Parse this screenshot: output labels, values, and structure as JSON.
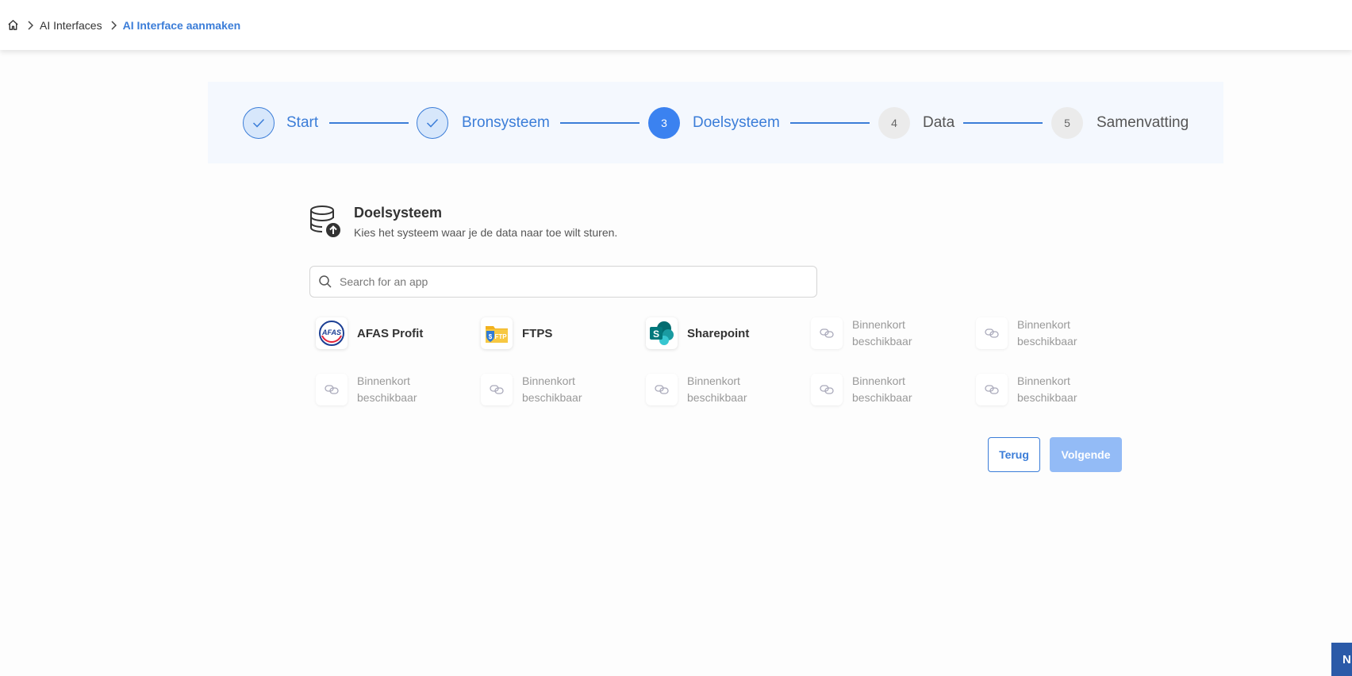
{
  "breadcrumb": {
    "home_icon": "home-icon",
    "items": [
      "AI Interfaces",
      "AI Interface aanmaken"
    ]
  },
  "stepper": {
    "steps": [
      {
        "number": "1",
        "label": "Start",
        "state": "done"
      },
      {
        "number": "2",
        "label": "Bronsysteem",
        "state": "done"
      },
      {
        "number": "3",
        "label": "Doelsysteem",
        "state": "active"
      },
      {
        "number": "4",
        "label": "Data",
        "state": "todo"
      },
      {
        "number": "5",
        "label": "Samenvatting",
        "state": "todo"
      }
    ]
  },
  "section": {
    "icon": "database-upload-icon",
    "title": "Doelsysteem",
    "subtitle": "Kies het systeem waar je de data naar toe wilt sturen."
  },
  "search": {
    "placeholder": "Search for an app",
    "value": ""
  },
  "apps": [
    {
      "name": "AFAS Profit",
      "logo": "afas-logo"
    },
    {
      "name": "FTPS",
      "logo": "ftp-logo"
    },
    {
      "name": "Sharepoint",
      "logo": "sharepoint-logo"
    },
    {
      "name": "Binnenkort beschikbaar",
      "logo": "link-icon"
    },
    {
      "name": "Binnenkort beschikbaar",
      "logo": "link-icon"
    },
    {
      "name": "Binnenkort beschikbaar",
      "logo": "link-icon"
    },
    {
      "name": "Binnenkort beschikbaar",
      "logo": "link-icon"
    },
    {
      "name": "Binnenkort beschikbaar",
      "logo": "link-icon"
    },
    {
      "name": "Binnenkort beschikbaar",
      "logo": "link-icon"
    },
    {
      "name": "Binnenkort beschikbaar",
      "logo": "link-icon"
    }
  ],
  "buttons": {
    "back": "Terug",
    "next": "Volgende"
  },
  "corner_badge": "N",
  "colors": {
    "accent": "#3b7dd8",
    "active_step": "#3b82f0",
    "disabled_button": "#93bbf6"
  }
}
